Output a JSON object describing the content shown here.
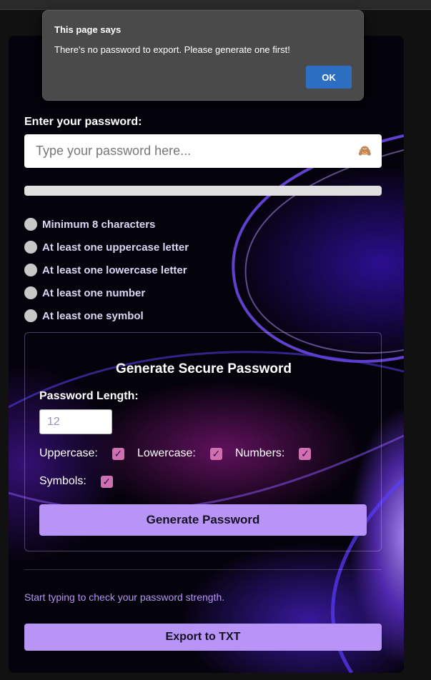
{
  "password_section": {
    "label": "Enter your password:",
    "placeholder": "Type your password here...",
    "eye_icon": "🙈",
    "strength_progress": 0.0
  },
  "requirements": [
    "Minimum 8 characters",
    "At least one uppercase letter",
    "At least one lowercase letter",
    "At least one number",
    "At least one symbol"
  ],
  "generator": {
    "title": "Generate Secure Password",
    "length_label": "Password Length:",
    "length_placeholder": "12",
    "options": {
      "uppercase": "Uppercase:",
      "lowercase": "Lowercase:",
      "numbers": "Numbers:",
      "symbols": "Symbols:"
    },
    "checkmark": "✓",
    "button_label": "Generate Password"
  },
  "status_text": "Start typing to check your password strength.",
  "export_button": "Export to TXT",
  "dialog": {
    "title": "This page says",
    "message": "There's no password to export. Please generate one first!",
    "ok_label": "OK"
  },
  "colors": {
    "accent": "#b794f6",
    "checkbox": "#d070b0",
    "dialog_button": "#2c6fc2"
  }
}
